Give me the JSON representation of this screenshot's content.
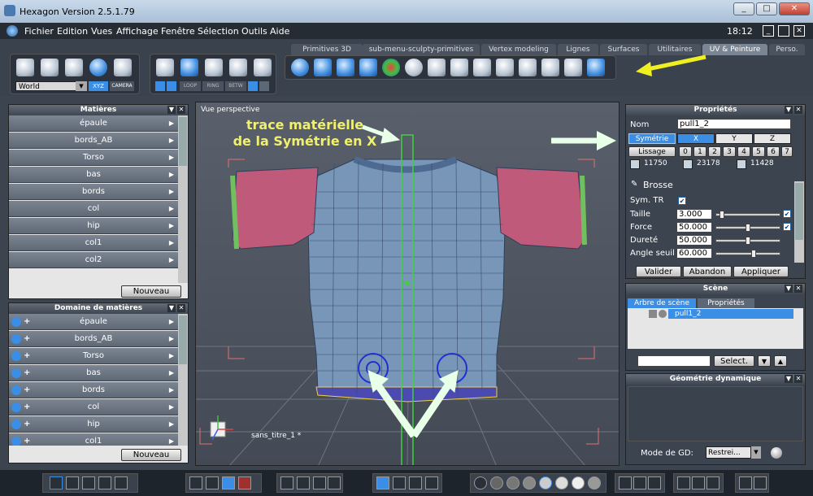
{
  "window": {
    "title": "Hexagon Version 2.5.1.79",
    "min": "_",
    "max": "□",
    "close": "✕",
    "clock": "18:12"
  },
  "menu": [
    "Fichier",
    "Edition",
    "Vues",
    "Affichage",
    "Fenêtre",
    "Sélection",
    "Outils",
    "Aide"
  ],
  "toolbar": {
    "space": "World",
    "xyz": "XYZ",
    "camera": "CAMERA",
    "loop": "LOOP",
    "ring": "RING",
    "betw": "BETW"
  },
  "tabs": [
    "Primitives 3D",
    "sub-menu-sculpty-primitives",
    "Vertex modeling",
    "Lignes",
    "Surfaces",
    "Utilitaires",
    "UV & Peinture",
    "Perso."
  ],
  "active_tab": "UV & Peinture",
  "materials": {
    "title": "Matières",
    "items": [
      "épaule",
      "bords_AB",
      "Torso",
      "bas",
      "bords",
      "col",
      "hip",
      "col1",
      "col2"
    ],
    "new_button": "Nouveau"
  },
  "domains": {
    "title": "Domaine de matières",
    "items": [
      "épaule",
      "bords_AB",
      "Torso",
      "bas",
      "bords",
      "col",
      "hip",
      "col1"
    ],
    "new_button": "Nouveau"
  },
  "viewport": {
    "label": "Vue perspective",
    "annotation_line1": "trace matérielle",
    "annotation_line2": "de la Symétrie en X",
    "object_label": "sans_titre_1 *"
  },
  "properties": {
    "title": "Propriétés",
    "name_label": "Nom",
    "name_value": "pull1_2",
    "symmetry_button": "Symétrie",
    "axes": [
      "X",
      "Y",
      "Z"
    ],
    "smooth_button": "Lissage",
    "smooth_levels": [
      "0",
      "1",
      "2",
      "3",
      "4",
      "5",
      "6",
      "7"
    ],
    "counts": [
      "11750",
      "23178",
      "11428"
    ],
    "brush_label": "Brosse",
    "sym_tr_label": "Sym. TR",
    "sym_tr_checked": "✔",
    "params": [
      {
        "label": "Taille",
        "value": "3.000",
        "fraction": 0.05
      },
      {
        "label": "Force",
        "value": "50.000",
        "fraction": 0.5
      },
      {
        "label": "Dureté",
        "value": "50.000",
        "fraction": 0.5
      },
      {
        "label": "Angle seuil",
        "value": "60.000",
        "fraction": 0.6
      }
    ],
    "validate": "Valider",
    "cancel": "Abandon",
    "apply": "Appliquer"
  },
  "scene": {
    "title": "Scène",
    "tabs": [
      "Arbre de scène",
      "Propriétés"
    ],
    "item": "pull1_2",
    "select_button": "Select."
  },
  "dyngeo": {
    "title": "Géométrie dynamique",
    "mode_label": "Mode de GD:",
    "mode_value": "Restrei..."
  },
  "colors": {
    "annotation": "#f0f070",
    "arrow": "#e8ffe8",
    "yellow_arrow": "#f0f020",
    "accent": "#3a8ee6"
  }
}
